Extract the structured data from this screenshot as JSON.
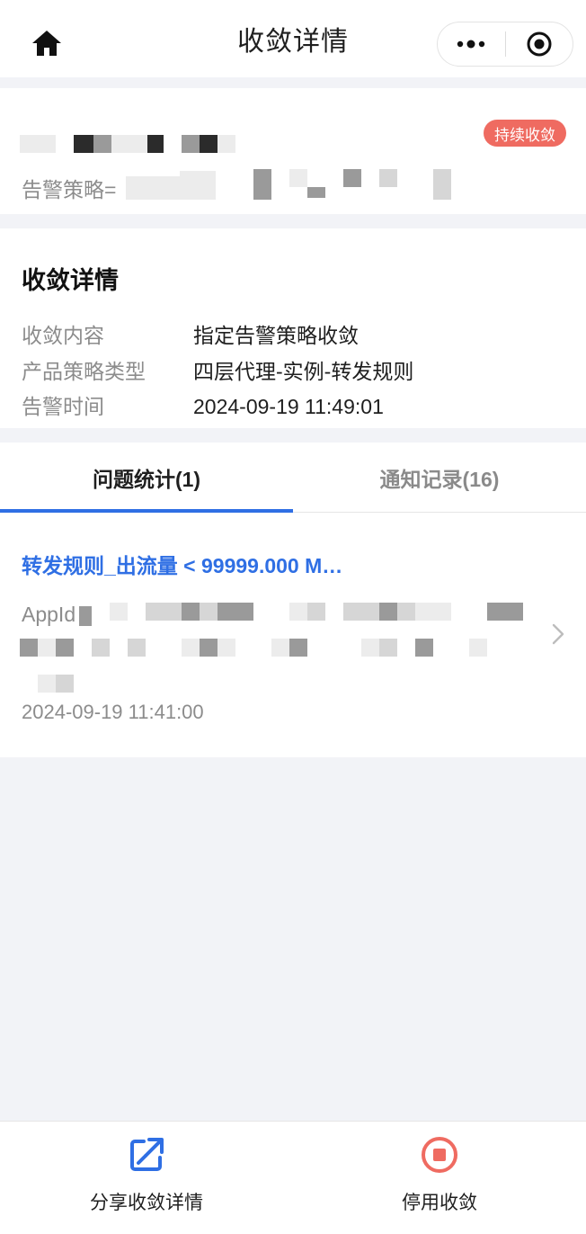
{
  "navbar": {
    "title": "收敛详情",
    "home_icon": "home-icon",
    "more_icon": "more-dots-icon",
    "close_icon": "target-circle-icon"
  },
  "alert": {
    "badge": "持续收敛",
    "policy_prefix": "告警策略=",
    "accent_color": "#ef6b61"
  },
  "details": {
    "title": "收敛详情",
    "rows": [
      {
        "label": "收敛内容",
        "value": "指定告警策略收敛"
      },
      {
        "label": "产品策略类型",
        "value": "四层代理-实例-转发规则"
      },
      {
        "label": "告警时间",
        "value": "2024-09-19 11:49:01"
      }
    ]
  },
  "tabs": [
    {
      "label": "问题统计(1)",
      "active": true
    },
    {
      "label": "通知记录(16)",
      "active": false
    }
  ],
  "issue": {
    "title": "转发规则_出流量 < 99999.000 M…",
    "appid_prefix": "AppId",
    "time": "2024-09-19 11:41:00"
  },
  "bottom": {
    "share_label": "分享收敛详情",
    "stop_label": "停用收敛",
    "share_color": "#2f6fe4",
    "stop_color": "#ef6b61"
  }
}
